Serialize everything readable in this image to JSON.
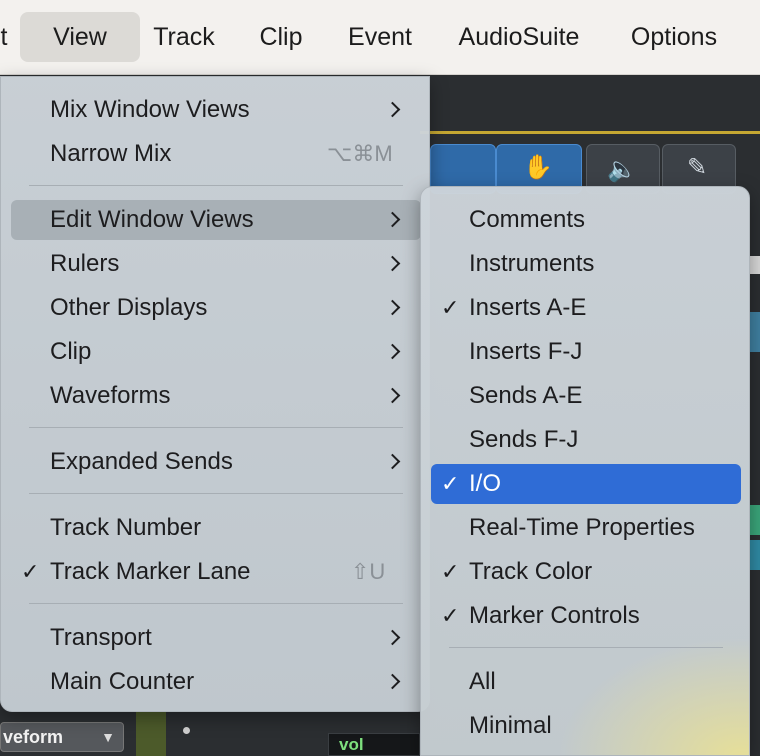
{
  "menubar": {
    "items": [
      {
        "label": "t"
      },
      {
        "label": "View"
      },
      {
        "label": "Track"
      },
      {
        "label": "Clip"
      },
      {
        "label": "Event"
      },
      {
        "label": "AudioSuite"
      },
      {
        "label": "Options"
      }
    ]
  },
  "background": {
    "waveform_select": "veform",
    "vol_label": "vol"
  },
  "view_menu": {
    "items": [
      {
        "label": "Mix Window Views"
      },
      {
        "label": "Narrow Mix",
        "shortcut": "⌥⌘M"
      },
      {
        "label": "Edit Window Views"
      },
      {
        "label": "Rulers"
      },
      {
        "label": "Other Displays"
      },
      {
        "label": "Clip"
      },
      {
        "label": "Waveforms"
      },
      {
        "label": "Expanded Sends"
      },
      {
        "label": "Track Number"
      },
      {
        "label": "Track Marker Lane",
        "shortcut": "⇧U"
      },
      {
        "label": "Transport"
      },
      {
        "label": "Main Counter"
      }
    ]
  },
  "edit_window_views_menu": {
    "items": [
      {
        "label": "Comments"
      },
      {
        "label": "Instruments"
      },
      {
        "label": "Inserts A-E"
      },
      {
        "label": "Inserts F-J"
      },
      {
        "label": "Sends A-E"
      },
      {
        "label": "Sends F-J"
      },
      {
        "label": "I/O"
      },
      {
        "label": "Real-Time Properties"
      },
      {
        "label": "Track Color"
      },
      {
        "label": "Marker Controls"
      },
      {
        "label": "All"
      },
      {
        "label": "Minimal"
      }
    ]
  },
  "checkmark": "✓",
  "colors": {
    "selection": "#2f6cd6",
    "hover": "#a8b0b6",
    "menubar_bg": "#f3f1ee"
  }
}
